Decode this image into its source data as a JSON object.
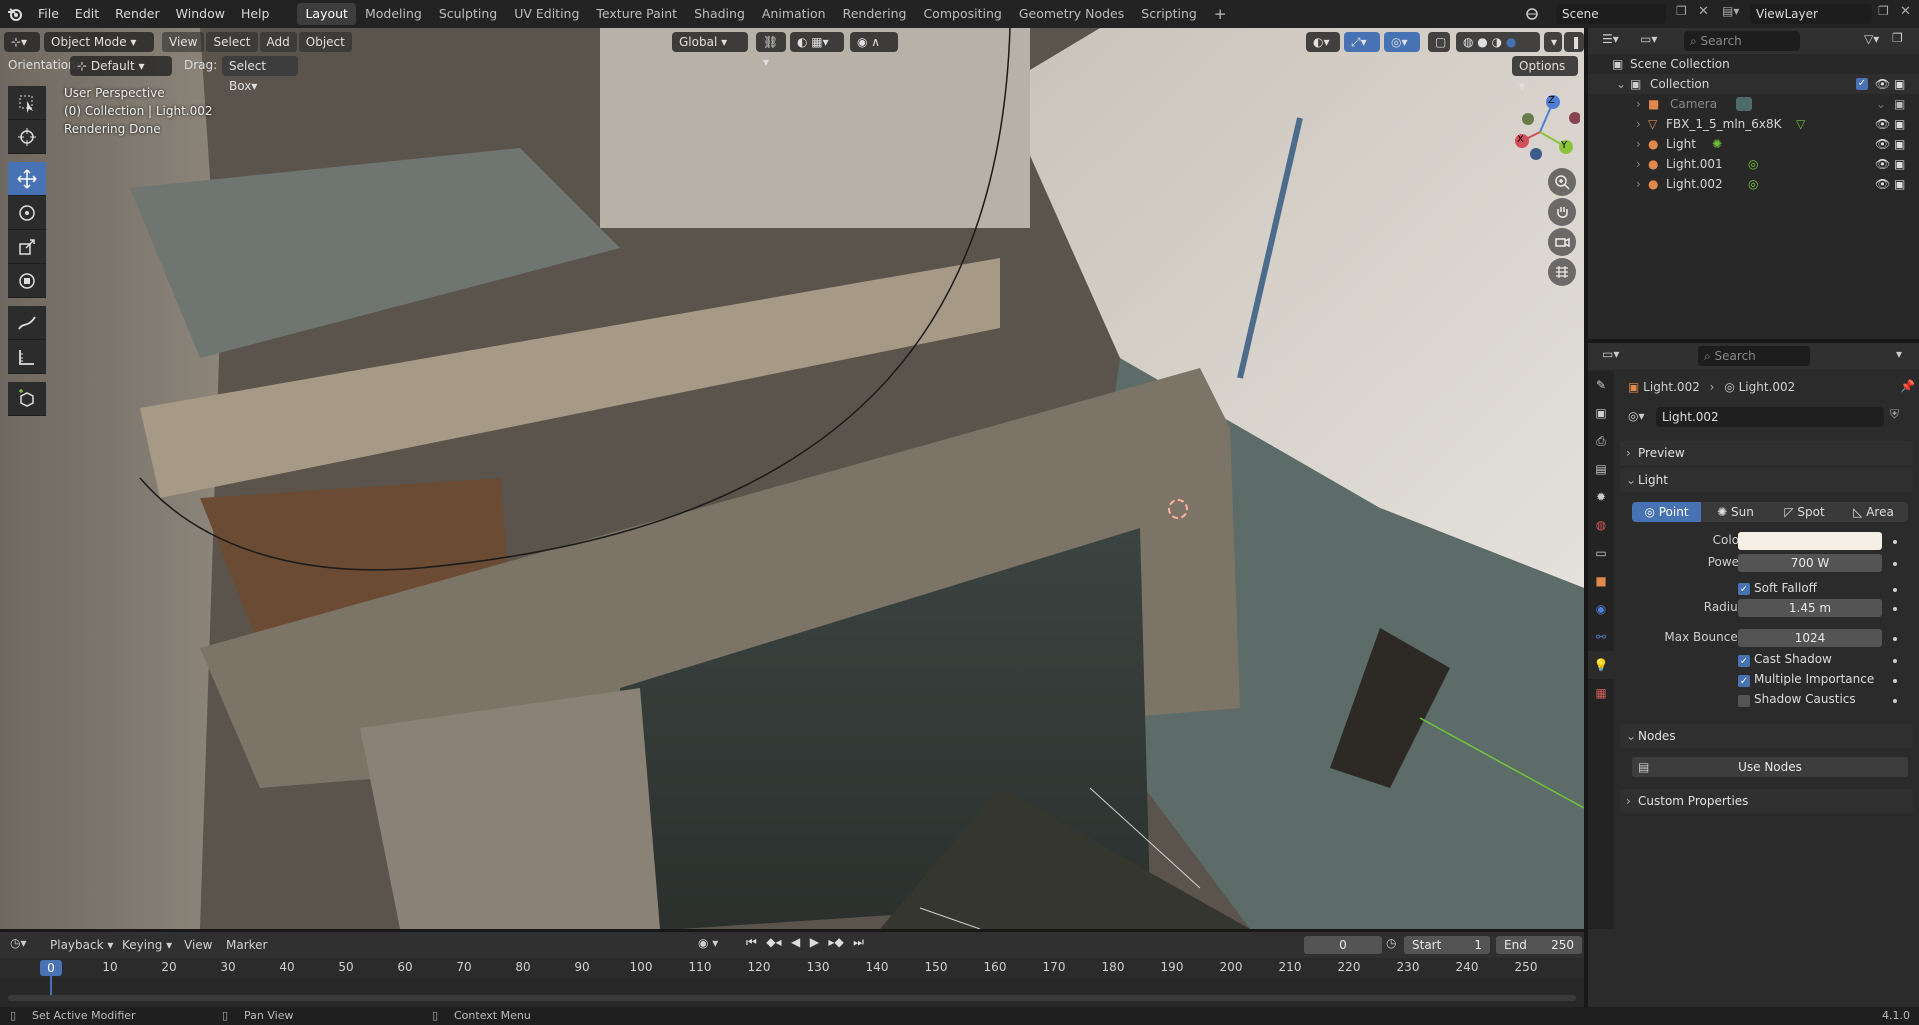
{
  "topbar": {
    "menus": [
      "File",
      "Edit",
      "Render",
      "Window",
      "Help"
    ],
    "workspaces": [
      "Layout",
      "Modeling",
      "Sculpting",
      "UV Editing",
      "Texture Paint",
      "Shading",
      "Animation",
      "Rendering",
      "Compositing",
      "Geometry Nodes",
      "Scripting"
    ],
    "active_workspace": "Layout",
    "add_tab": "+",
    "scene_name": "Scene",
    "view_layer": "ViewLayer"
  },
  "viewport": {
    "mode": "Object Mode",
    "menus": [
      "View",
      "Select",
      "Add",
      "Object"
    ],
    "transform_orientation": "Global",
    "orientation_label": "Orientation:",
    "orientation_value": "Default",
    "drag_label": "Drag:",
    "drag_value": "Select Box",
    "options_label": "Options",
    "overlay_line1": "User Perspective",
    "overlay_line2": "(0) Collection | Light.002",
    "overlay_line3": "Rendering Done",
    "gizmo": {
      "x": "X",
      "y": "Y",
      "z": "Z"
    }
  },
  "outliner": {
    "search_placeholder": "Search",
    "scene_collection": "Scene Collection",
    "collection": "Collection",
    "items": [
      {
        "name": "Camera",
        "dimmed": true
      },
      {
        "name": "FBX_1_5_mln_6x8K",
        "dimmed": false
      },
      {
        "name": "Light",
        "dimmed": false
      },
      {
        "name": "Light.001",
        "dimmed": false
      },
      {
        "name": "Light.002",
        "dimmed": false
      }
    ]
  },
  "properties": {
    "search_placeholder": "Search",
    "breadcrumb_object": "Light.002",
    "breadcrumb_data": "Light.002",
    "datablock": "Light.002",
    "panels": {
      "preview": "Preview",
      "light": "Light",
      "nodes": "Nodes",
      "custom": "Custom Properties"
    },
    "light_types": [
      "Point",
      "Sun",
      "Spot",
      "Area"
    ],
    "active_light_type": "Point",
    "color_label": "Color",
    "color_value": "#f5efe6",
    "power_label": "Power",
    "power_value": "700 W",
    "soft_falloff": "Soft Falloff",
    "radius_label": "Radius",
    "radius_value": "1.45 m",
    "max_bounces_label": "Max Bounces",
    "max_bounces_value": "1024",
    "cast_shadow": "Cast Shadow",
    "multiple_importance": "Multiple Importance",
    "shadow_caustics": "Shadow Caustics",
    "use_nodes": "Use Nodes"
  },
  "timeline": {
    "menus": [
      "Playback",
      "Keying",
      "View",
      "Marker"
    ],
    "current_frame": "0",
    "start_label": "Start",
    "start_value": "1",
    "end_label": "End",
    "end_value": "250",
    "playhead": "0",
    "ticks": [
      "10",
      "20",
      "30",
      "40",
      "50",
      "60",
      "70",
      "80",
      "90",
      "100",
      "110",
      "120",
      "130",
      "140",
      "150",
      "160",
      "170",
      "180",
      "190",
      "200",
      "210",
      "220",
      "230",
      "240",
      "250"
    ]
  },
  "statusbar": {
    "hint1": "Set Active Modifier",
    "hint2": "Pan View",
    "hint3": "Context Menu",
    "version": "4.1.0"
  },
  "colors": {
    "accent": "#4772b3",
    "bg": "#232323"
  }
}
